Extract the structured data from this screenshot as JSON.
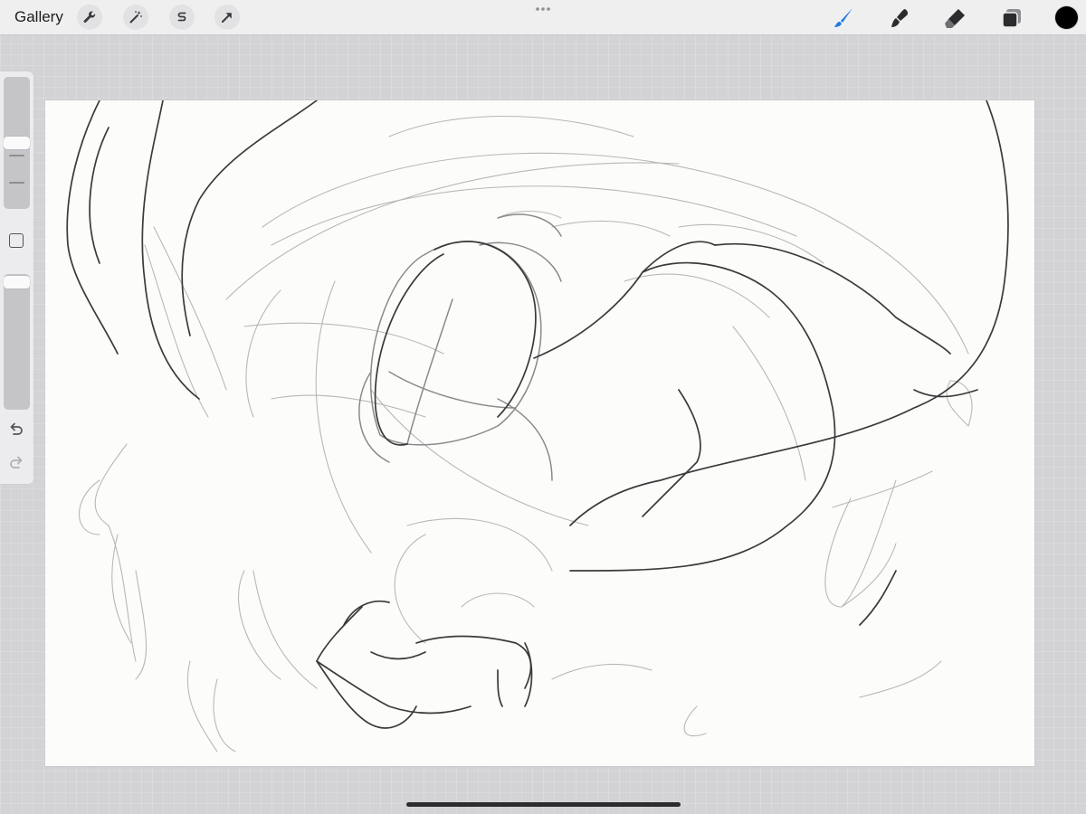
{
  "topbar": {
    "gallery_label": "Gallery",
    "left_tools": [
      "wrench-icon",
      "magic-wand-icon",
      "selection-s-icon",
      "transform-arrow-icon"
    ],
    "right_tools": [
      "brush-icon",
      "smudge-icon",
      "eraser-icon",
      "layers-icon"
    ],
    "active_tool": "brush-icon"
  },
  "colors": {
    "accent": "#1f7ae0",
    "current_color": "#000000",
    "canvas_bg": "#fcfcfb",
    "workspace_bg": "#d3d3d6"
  },
  "sidebar": {
    "brush_size_level": 0.15,
    "opacity_level": 1.0,
    "controls": [
      "brush-size-slider",
      "modify-button",
      "opacity-slider",
      "undo-icon",
      "redo-icon"
    ]
  }
}
